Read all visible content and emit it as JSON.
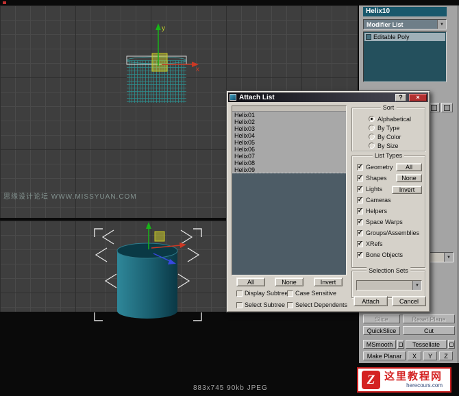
{
  "viewport_top": {
    "axis_x_label": "x",
    "axis_y_label": "y",
    "watermark_text": "思缘设计论坛 WWW.MISSYUAN.COM"
  },
  "command_panel": {
    "object_name": "Helix10",
    "modifier_dropdown_label": "Modifier List",
    "modifier_stack": [
      "Editable Poly"
    ],
    "edit_geometry": {
      "slice": "Slice",
      "reset_plane": "Reset Plane",
      "quickslice": "QuickSlice",
      "cut": "Cut",
      "msmooth": "MSmooth",
      "tessellate": "Tessellate",
      "make_planar": "Make Planar",
      "axis_x": "X",
      "axis_y": "Y",
      "axis_z": "Z"
    }
  },
  "attach_dialog": {
    "title": "Attach List",
    "help_button": "?",
    "close_button": "×",
    "list_items": [
      "Helix01",
      "Helix02",
      "Helix03",
      "Helix04",
      "Helix05",
      "Helix06",
      "Helix07",
      "Helix08",
      "Helix09"
    ],
    "sort_group": {
      "label": "Sort",
      "options": [
        "Alphabetical",
        "By Type",
        "By Color",
        "By Size"
      ],
      "selected": "Alphabetical"
    },
    "list_types_group": {
      "label": "List Types",
      "options": [
        "Geometry",
        "Shapes",
        "Lights",
        "Cameras",
        "Helpers",
        "Space Warps",
        "Groups/Assemblies",
        "XRefs",
        "Bone Objects"
      ],
      "buttons": {
        "all": "All",
        "none": "None",
        "invert": "Invert"
      }
    },
    "selection_sets_group": {
      "label": "Selection Sets"
    },
    "selection_buttons": {
      "all": "All",
      "none": "None",
      "invert": "Invert"
    },
    "options": {
      "display_subtree": "Display Subtree",
      "case_sensitive": "Case Sensitive",
      "select_subtree": "Select Subtree",
      "select_dependents": "Select Dependents"
    },
    "attach_button": "Attach",
    "cancel_button": "Cancel"
  },
  "status_bar": {
    "text": "883x745 90kb JPEG"
  },
  "footer_logo": {
    "glyph": "Z",
    "site_name": "这里教程网",
    "site_url": "herecours.com"
  },
  "colors": {
    "accent_teal": "#19586c",
    "close_red": "#b23030",
    "brand_red": "#d42222",
    "viewport_bg": "#3e3e3e"
  }
}
